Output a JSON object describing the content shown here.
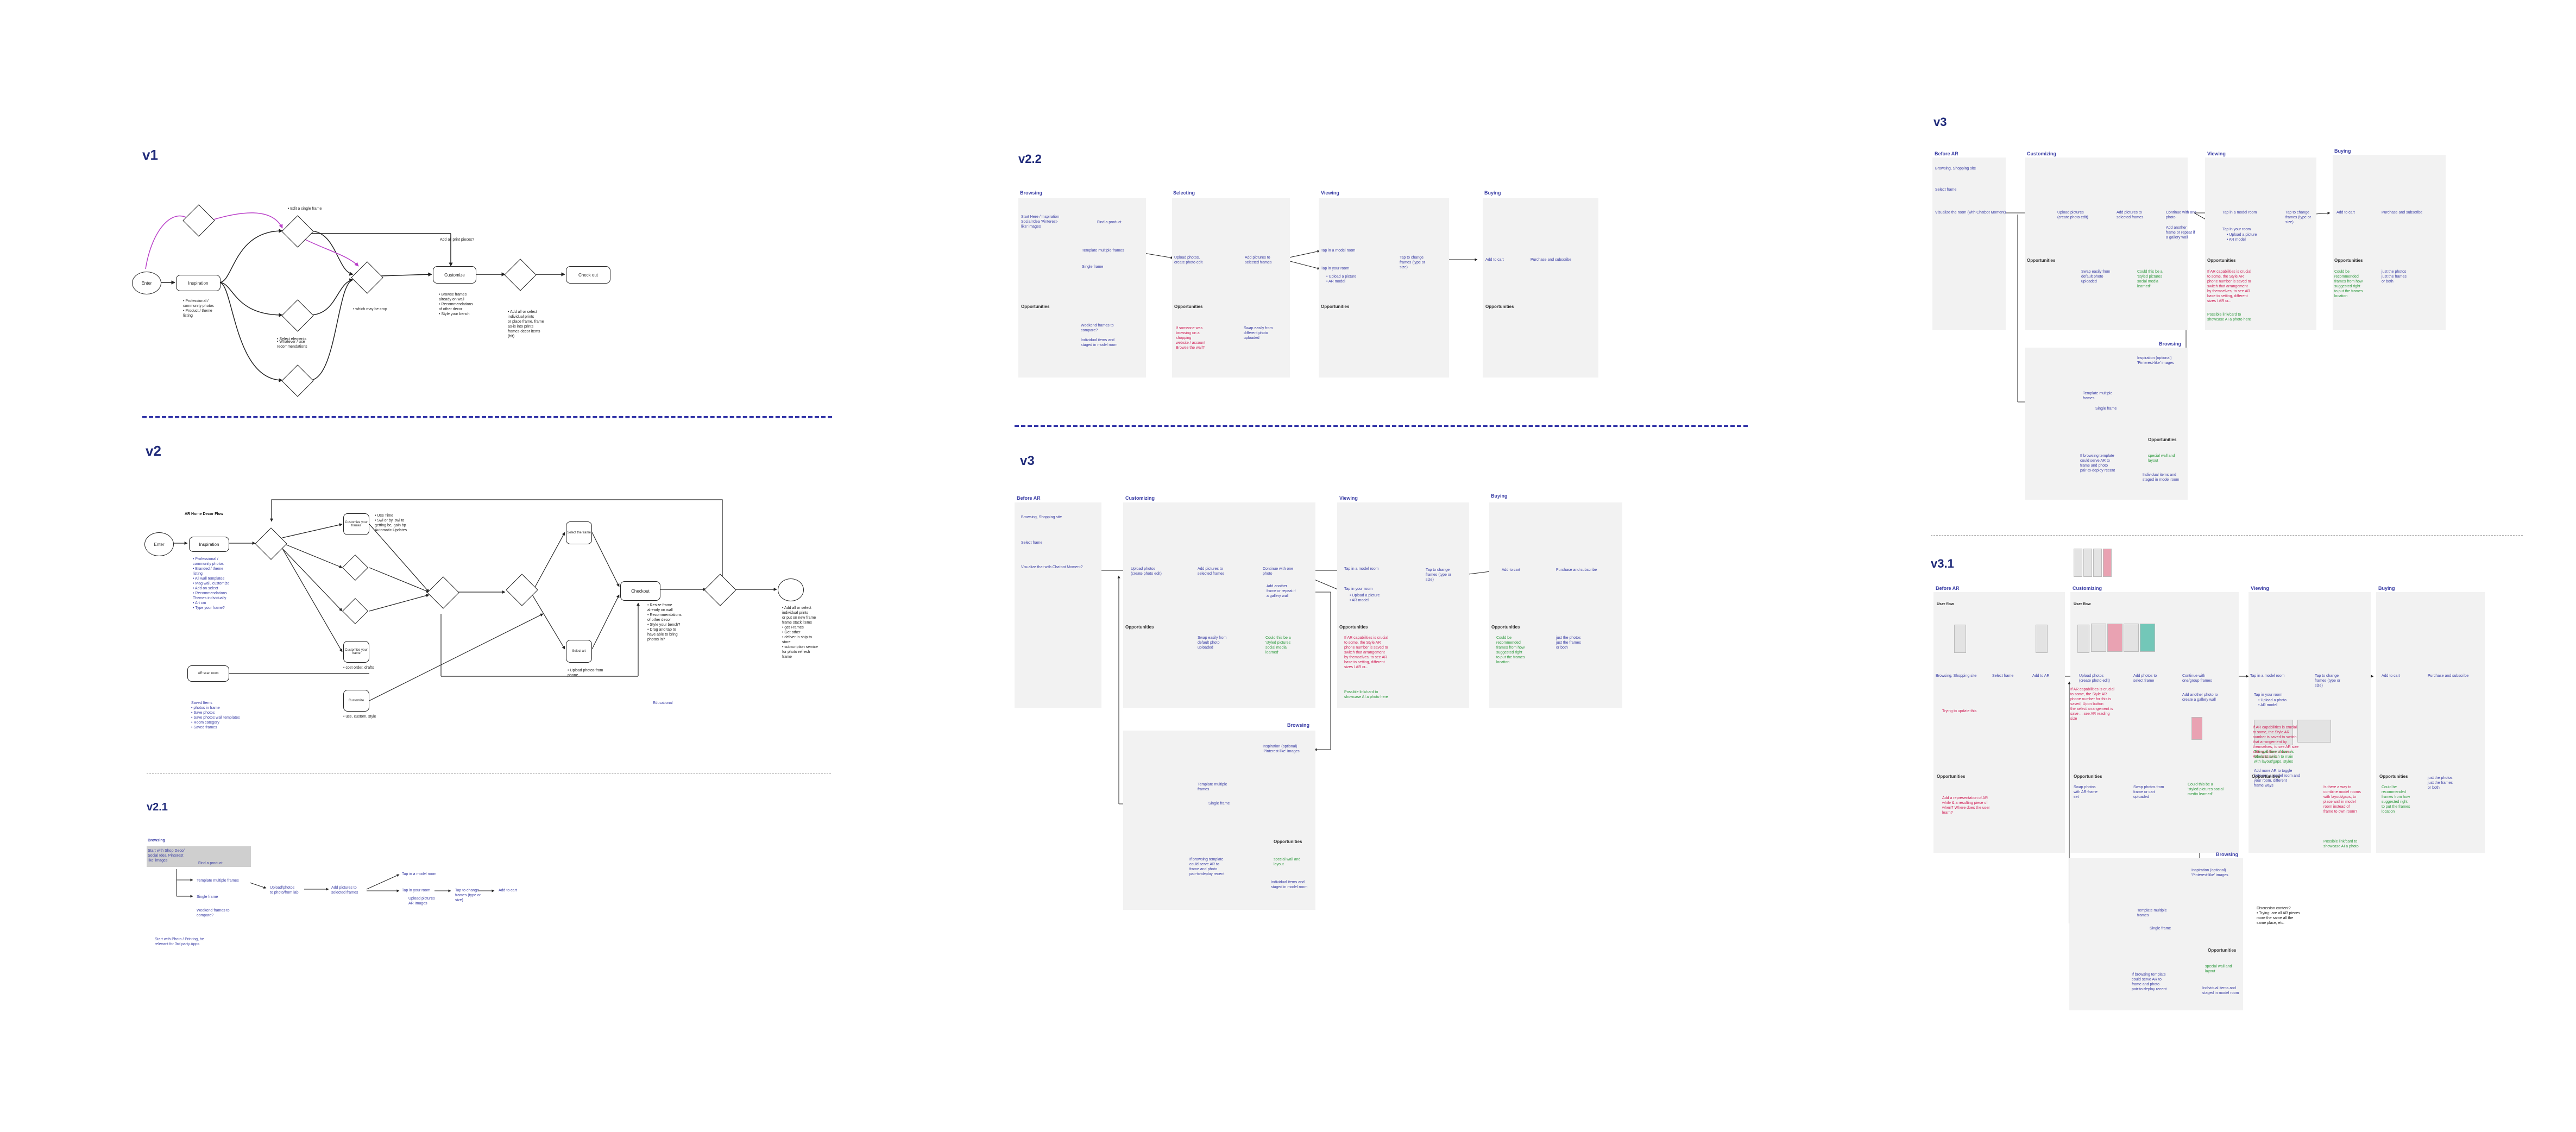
{
  "sections": {
    "v1": "v1",
    "v2": "v2",
    "v21": "v2.1",
    "v22": "v2.2",
    "v3_mid": "v3",
    "v3_right": "v3",
    "v31": "v3.1"
  },
  "stages": {
    "before_ar": "Before AR",
    "browsing": "Browsing",
    "selecting": "Selecting",
    "customizing": "Customizing",
    "viewing": "Viewing",
    "buying": "Buying",
    "opportunities": "Opportunities",
    "user_flow": "User flow"
  },
  "v1": {
    "start": "Enter",
    "inspiration": "Inspiration",
    "customize": "Customize",
    "check_out": "Check out",
    "bullets_inspiration": "• Professional /\n  community photos\n• Product / theme\n  listing",
    "bullets_customize": "• Browse frames\n  already on wall\n• Recommendations\n  of other decor\n• Style your bench",
    "bullets_check": "• Add all or select\n  individual prints\n  or place frame, frame\n  as-is into prints\n  frames decor items\n  (hit)",
    "side_note": "• Edit a single frame",
    "wall_note": "• Select elements",
    "reference": "• Whatever / use\n  recommendations",
    "arr_note": "• which may be crop",
    "add_note": "Add all print pieces?"
  },
  "v2": {
    "flow_title": "AR Home Decor Flow",
    "start": "Enter",
    "inspiration": "Inspiration",
    "ar_scan": "AR scan room",
    "customize_frames": "Customize your frames",
    "customize_art": "Customize your frame",
    "customize2": "Customize",
    "checkout": "Checkout",
    "select_frame": "Select the frame",
    "select_art": "Select art",
    "bullets_insp": "• Professional /\n  community photos\n• Branded / theme\n  listing\n• All wall templates\n• Mag wall, customize\n• Add on select\n• Recommendations\n  Themes individually\n• Art cm\n• Type your frame?",
    "saved_items": "Saved Items\n• photos in frame\n• Save photos\n• Save photos wall templates\n• Room category\n• Saved frames",
    "wall_notes": "• Use Time\n• Swi or by, swi to\n  getting be, gain bp\n  Automatic Updates",
    "check_notes": "• Resize frame\n  already on wall\n• Recommendations\n  of other decor\n• Style your bench?\n• Drag and tap to\n  have able to bring\n  photos in?",
    "final_notes": "• Add all or select\n  individual prints\n  or put on new frame\n  frame stack items\n• get Frames\n• Get other\n• deliver in ship to\n  store\n• subscription service\n  for photo refresh\n  frame",
    "order_note": "• cost order, drafts",
    "educational": "Educational",
    "photo_note": "• Upload photos from\n  phone",
    "cust_note": "• use, custom, style",
    "insta": "Instagram, Facebook Pinterest,\n  hide"
  },
  "v21": {
    "browsing": "Browsing",
    "inspiration": "Start with Shop Deco/\nSocial Idea 'Pinterest\nlike' images",
    "find_product": "Find a product",
    "template": "Template multiple frames",
    "single": "Single frame",
    "upload": "Upload/photos\nto photo/from lab",
    "add_pictures": "Add pictures to\nselected frames",
    "tap_model": "Tap in a model room",
    "tap_own": "Tap in your room",
    "tap_change": "Tap to change\nframes (type or\nsize)",
    "add_cart": "Add to cart",
    "upload_camera": "Upload pictures\nAR Images",
    "weekend": "Weekend frames to\ncompare?",
    "note": "Start with Photo / Printing, be\nrelevant for 3rd party Apps"
  },
  "v22": {
    "inspiration": "Start Here / Inspiration\nSocial Idea 'Pinterest-\nlike' images",
    "find_product": "Find a product",
    "template": "Template multiple frames",
    "single": "Single frame",
    "upload": "Upload photos,\ncreate photo edit",
    "add_pictures": "Add pictures to\nselected frames",
    "tap_model": "Tap in a model room",
    "tap_own": "Tap in your room",
    "own_bullets": "• Upload a picture\n• AR model",
    "tap_change": "Tap to change\nframes (type or\nsize)",
    "add_cart": "Add to cart",
    "purchase": "Purchase and subscribe",
    "opp_browse": "Weekend frames to\ncompare?\n\nIndividual items and\nstaged in model room",
    "opp_select_red": "If someone was\nbrowsing on a\nshopping\nwebsite / account\nBrowse the wall?",
    "opp_select_blue": "Swap easily from\ndifferent photo\nuploaded"
  },
  "v3m": {
    "browsing_shop": "Browsing, Shopping site",
    "select_frame": "Select frame",
    "visualize": "Visualize that with Chatbot Moment?",
    "upload": "Upload photos\n(create photo edit)",
    "add_pictures": "Add pictures to\nselected frames",
    "continue": "Continue with one\nphoto",
    "add_another": "Add another\nframe or repeat if\na gallery wall",
    "tap_model": "Tap in a model room",
    "tap_own": "Tap in your room",
    "own_bullets": "• Upload a picture\n• AR model",
    "tap_change": "Tap to change\nframes (type or\nsize)",
    "add_cart": "Add to cart",
    "purchase": "Purchase and subscribe",
    "opp_cust_blue": "Swap easily from\ndefault photo\nuploaded",
    "opp_cust_grn": "Could this be a\n'styled pictures\nsocial media\nlearned'",
    "opp_view_red": "If AR capabilities is crucial\nto some, the Style AR\nphone number is saved to\nswitch that arrangement\nby themselves, to see AR\nbase to setting, different\nsizes / AR cr...",
    "opp_view_grn": "Possible link/card to\nshowcase AI a photo here",
    "opp_buy": "Could be\nrecommended\nframes from how\nsuggested right\nto put the frames\nlocation",
    "opp_buy2": "just the photos\njust the frames\nor both",
    "browsing_box": "Browsing",
    "inspiration": "Inspiration (optional)\n'Pinterest-like' images",
    "template": "Template multiple\nframes",
    "single": "Single frame",
    "opp2_blue": "If browsing template\ncould serve AR to\nframe and photo\npair-to-deploy recent",
    "opp2_grn": "special wall and\nlayout",
    "opp2_blue2": "Individual items and\nstaged in model room"
  },
  "v3r": {
    "browsing_shop": "Browsing, Shopping site",
    "select_frame": "Select frame",
    "visualize": "Visualize the room (with Chatbot Moment)",
    "upload": "Upload pictures\n(create photo edit)",
    "add_pictures": "Add pictures to\nselected frames",
    "continue": "Continue with one\nphoto",
    "add_another": "Add another\nframe or repeat if\na gallery wall",
    "tap_model": "Tap in a model room",
    "tap_own": "Tap in your room",
    "own_bullets": "• Upload a picture\n• AR model",
    "tap_change": "Tap to change\nframes (type or\nsize)",
    "add_cart": "Add to cart",
    "purchase": "Purchase and subscribe",
    "opp_cust_blue": "Swap easily from\ndefault photo\nuploaded",
    "opp_cust_grn": "Could this be a\n'styled pictures\nsocial media\nlearned'",
    "opp_view_red": "If AR capabilities is crucial\nto some, the Style AR\nphone number is saved to\nswitch that arrangement\nby themselves, to see AR\nbase to setting, different\nsizes / AR cr...",
    "opp_view_grn": "Possible link/card to\nshowcase AI a photo here",
    "opp_buy": "Could be\nrecommended\nframes from how\nsuggested right\nto put the frames\nlocation",
    "opp_buy2": "just the photos\njust the frames\nor both",
    "browsing_box": "Browsing",
    "inspiration": "Inspiration (optional)\n'Pinterest-like' images",
    "template": "Template multiple\nframes",
    "single": "Single frame",
    "opp2_blue": "If browsing template\ncould serve AR to\nframe and photo\npair-to-deploy recent",
    "opp2_grn": "special wall and\nlayout",
    "opp2_blue2": "Individual items and\nstaged in model room"
  },
  "v31": {
    "browsing_shop": "Browsing, Shopping site",
    "select_frame": "Select frame",
    "add_ar": "Add to AR",
    "upload": "Upload photos\n(create photo edit)",
    "add_pictures": "Add photos to\nselect frame",
    "continue": "Continue with\none/group frames",
    "add_another": "Add another photo to\ncreate a gallery wall",
    "tap_model": "Tap in a model room",
    "tap_own": "Tap in your room",
    "own_bullets": "• Upload a photo\n• AR model",
    "tap_change": "Tap to change\nframes (type or\nsize)",
    "add_cart": "Add to cart",
    "purchase": "Purchase and subscribe",
    "before_red": "Trying to update this",
    "opp_before_red": "Add a representation of AR\nwhile & a resulting piece of\nwhen? Where does the user\nlearn?",
    "opp_cust_blue": "Swap photos\nwith AR-frame\nset",
    "opp_cust_blue2": "Swap photos from\nframe or cart\nuploaded",
    "opp_cust_grn": "Could this be a\n'styled pictures social\nmedia learned'",
    "cust_red": "If AR capabilities is crucial\nto some, the Style AR\nphone number for this is\nsaved, Upon button\nthe select arrangement is\nsave ... see AR reading\nsize",
    "view_red": "If AR capabilities is crucial\nto some, the Style AR\nnumber is saved to switch\nthat arrangement by\nthemselves, to see AR size\nsetting, different sizes /\nAR constraints",
    "view_blue": "Add more AR to toggle\nbetween a model room and\nyour room, different\nframe ways",
    "view_grn": "The wall view of frames\nlabels to switch to main\nwith layout/gaps, styles",
    "opp_view_red": "Is there a way to\ncombine model rooms\nwith layout/gaps, to\nplace wall in model\nroom instead of\nframe to own room?",
    "opp_view_grn": "Possible link/card to\nshowcase AI a photo",
    "opp_buy": "Could be\nrecommended\nframes from how\nsuggested right\nto put the frames\nlocation",
    "opp_buy2": "just the photos\njust the frames\nor both",
    "browsing_box": "Browsing",
    "inspiration": "Inspiration (optional)\n'Pinterest-like' images",
    "template": "Template multiple\nframes",
    "single": "Single frame",
    "opp2_blue": "If browsing template\ncould serve AR to\nframe and photo\npair-to-deploy recent",
    "opp2_grn": "special wall and\nlayout",
    "opp2_blue2": "Individual items and\nstaged in model room",
    "discussion": "Discussion content?\n• Trying: are all AR pieces\n  more the same all the\n  same place, etc."
  },
  "colors": {
    "title": "#1f2a7a",
    "ink": "#3b3fa5",
    "red": "#d1245a",
    "green": "#2e9a3e",
    "panel": "#f2f2f2",
    "separator": "#3436a8",
    "magenta": "#b93ec8"
  }
}
